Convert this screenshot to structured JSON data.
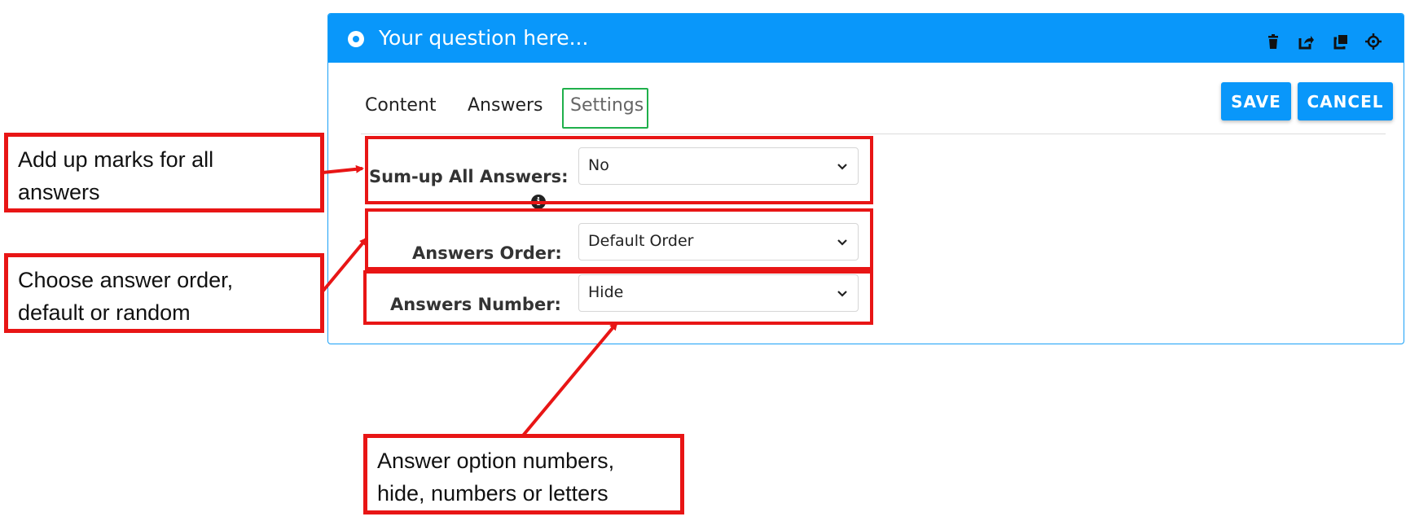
{
  "question": {
    "title": "Your question here...",
    "header_icons": [
      "trash-icon",
      "share-icon",
      "duplicate-icon",
      "target-icon"
    ]
  },
  "tabs": [
    {
      "label": "Content",
      "active": false
    },
    {
      "label": "Answers",
      "active": false
    },
    {
      "label": "Settings",
      "active": true
    }
  ],
  "actions": {
    "save": "SAVE",
    "cancel": "CANCEL"
  },
  "settings": {
    "sum_up": {
      "label": "Sum-up All Answers:",
      "value": "No"
    },
    "order": {
      "label": "Answers Order:",
      "value": "Default Order"
    },
    "number": {
      "label": "Answers Number:",
      "value": "Hide"
    }
  },
  "annotations": {
    "sum_up": [
      "Add up marks for all",
      "answers"
    ],
    "order": [
      "Choose answer order,",
      "default or random"
    ],
    "number": [
      "Answer option numbers,",
      "hide, numbers or letters"
    ]
  },
  "colors": {
    "header_blue": "#0997fa",
    "highlight_green": "#1fb04b",
    "annotation_red": "#e81515"
  }
}
